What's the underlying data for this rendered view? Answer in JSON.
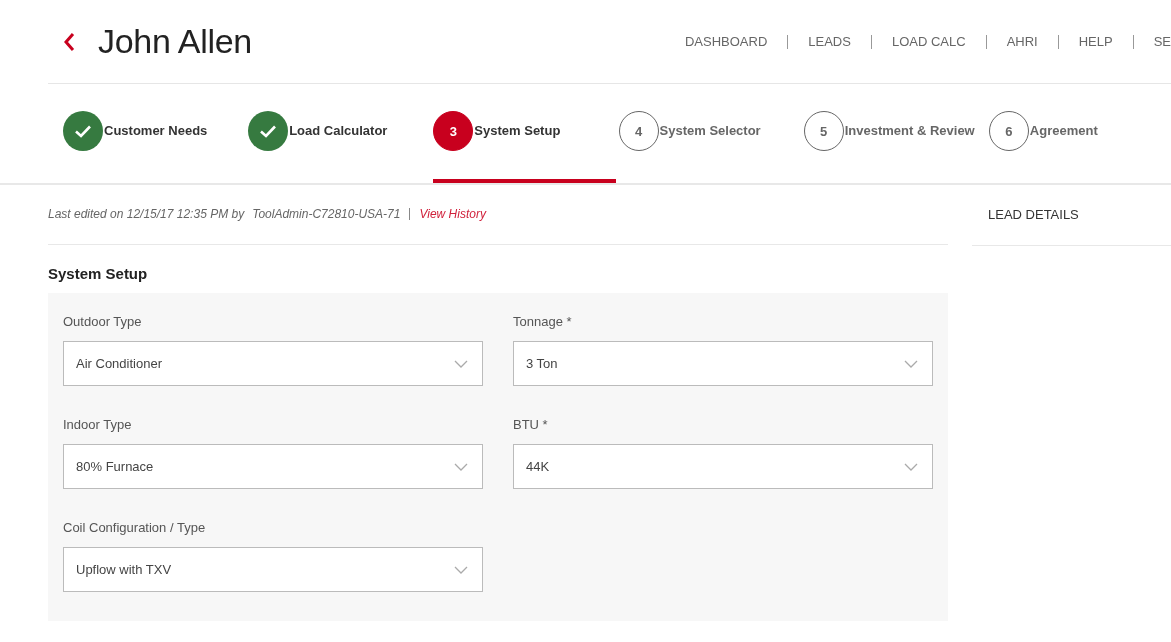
{
  "header": {
    "title": "John Allen",
    "nav": [
      "DASHBOARD",
      "LEADS",
      "LOAD CALC",
      "AHRI",
      "HELP",
      "SE"
    ]
  },
  "steps": [
    {
      "label": "Customer Needs",
      "completed": true,
      "selected": false
    },
    {
      "label": "Load Calculator",
      "completed": true,
      "selected": false
    },
    {
      "label": "System Setup",
      "number": "3",
      "completed": false,
      "selected": true
    },
    {
      "label": "System Selector",
      "number": "4",
      "completed": false,
      "selected": false
    },
    {
      "label": "Investment & Review",
      "number": "5",
      "completed": false,
      "selected": false
    },
    {
      "label": "Agreement",
      "number": "6",
      "completed": false,
      "selected": false
    }
  ],
  "edit_info": {
    "text": "Last edited on 12/15/17 12:35 PM by",
    "user": "ToolAdmin-C72810-USA-71",
    "link": "View History"
  },
  "section": {
    "title": "System Setup",
    "fields": [
      {
        "label": "Outdoor Type",
        "value": "Air Conditioner"
      },
      {
        "label": "Tonnage *",
        "value": "3 Ton"
      },
      {
        "label": "Indoor Type",
        "value": "80% Furnace"
      },
      {
        "label": "BTU *",
        "value": "44K"
      },
      {
        "label": "Coil Configuration / Type",
        "value": "Upflow with TXV"
      }
    ]
  },
  "side_panel": {
    "title": "LEAD DETAILS"
  }
}
